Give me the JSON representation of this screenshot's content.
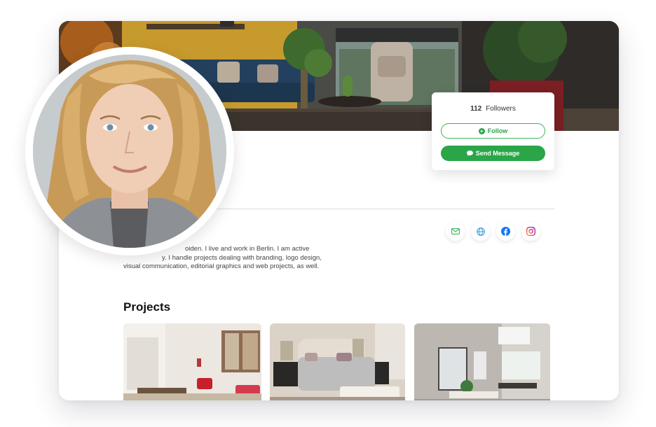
{
  "profile": {
    "followers_count": "112",
    "followers_label": "Followers",
    "follow_label": "Follow",
    "message_label": "Send Message",
    "bio_lines": [
      "oiden. I live and work in Berlin. I am active",
      "y. I handle projects dealing with branding, logo design,",
      "visual communication, editorial graphics and web projects, as well."
    ]
  },
  "socials": [
    {
      "icon": "mail-icon",
      "color": "#3cb55b"
    },
    {
      "icon": "globe-icon",
      "color": "#3a9ad9"
    },
    {
      "icon": "facebook-icon",
      "color": "#1877f2"
    },
    {
      "icon": "instagram-icon",
      "color": "#c13584"
    }
  ],
  "projects": {
    "title": "Projects"
  },
  "colors": {
    "accent": "#2aa547",
    "facebook": "#1877f2"
  }
}
